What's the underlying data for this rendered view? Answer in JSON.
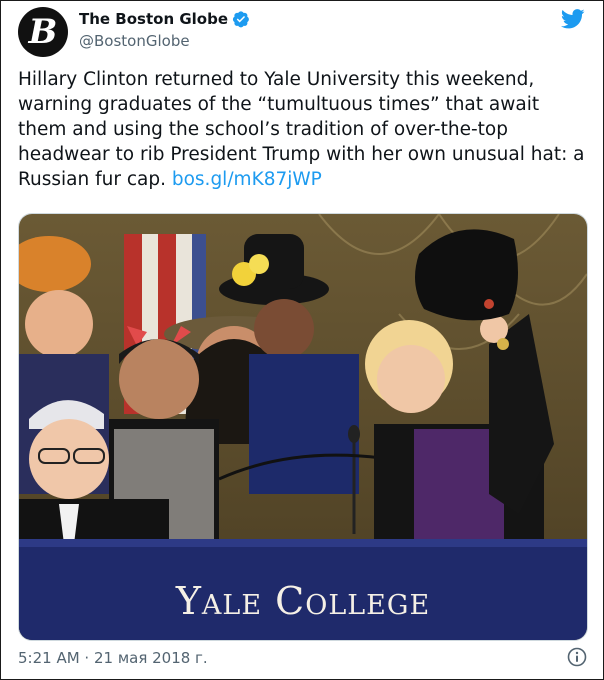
{
  "tweet": {
    "display_name": "The Boston Globe",
    "handle": "@BostonGlobe",
    "avatar_letter": "B",
    "verified": true,
    "text_body": "Hillary Clinton returned to Yale University this weekend, warning graduates of the “tumultuous times” that await them and using the school’s tradition of over-the-top headwear to rib President Trump with her own unusual hat: a Russian fur cap. ",
    "link_text": "bos.gl/mK87jWP",
    "timestamp": "5:21 AM · 21 мая 2018 г."
  },
  "photo": {
    "banner_text": "Yale College"
  },
  "icons": {
    "verified": "verified-badge-icon",
    "bird": "twitter-bird-icon",
    "info": "info-icon"
  },
  "colors": {
    "accent": "#1d9bf0",
    "text": "#0f1419",
    "muted": "#536471",
    "banner": "#1f2a6b"
  }
}
